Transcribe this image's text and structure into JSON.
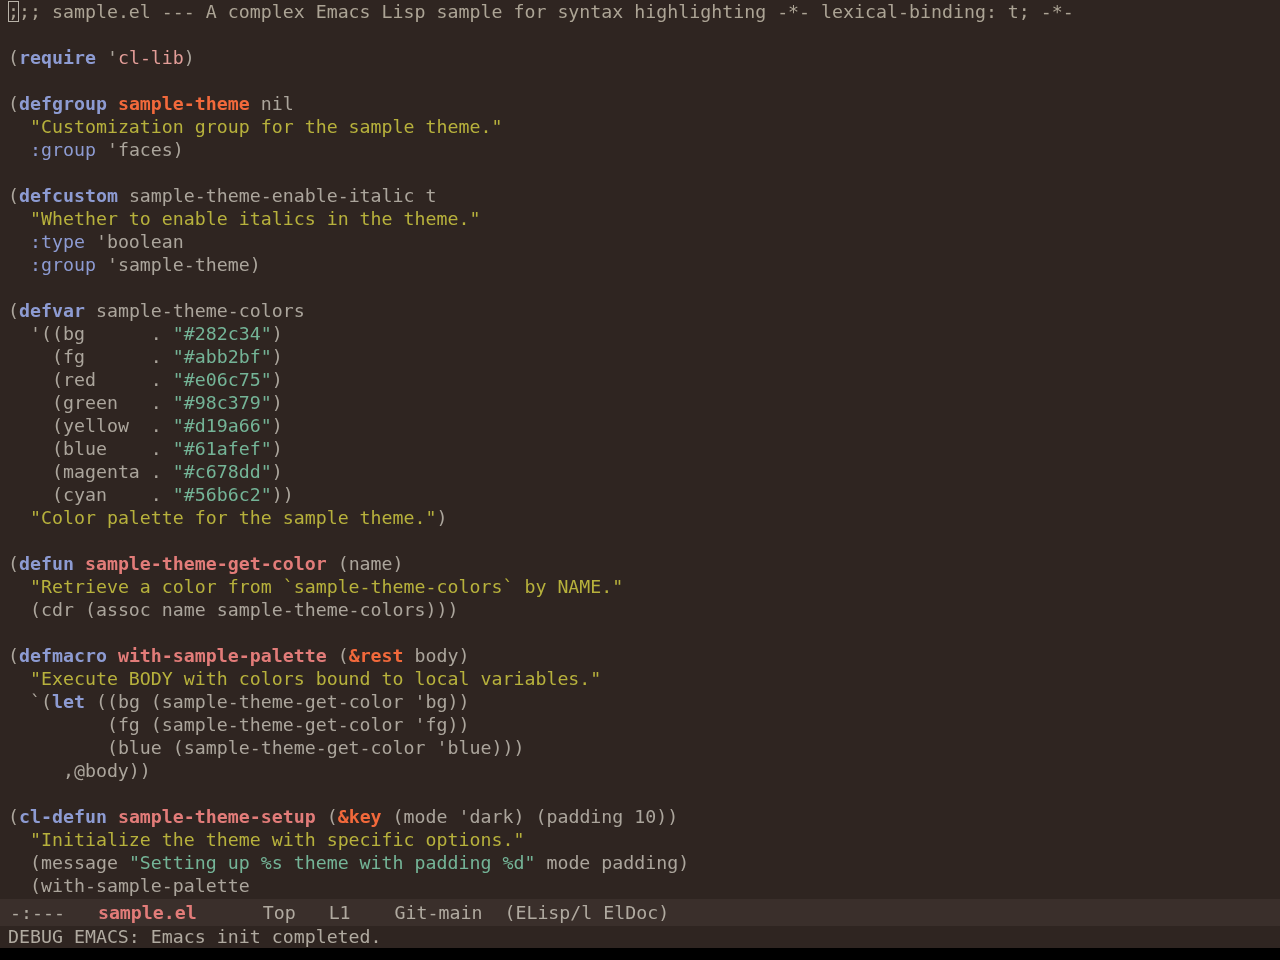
{
  "buffer": {
    "blocks": [
      {
        "lines": [
          {
            "segments": [
              {
                "text": ";",
                "kind": "comment",
                "cursor": true
              },
              {
                "text": ";; sample.el --- A complex Emacs Lisp sample for syntax highlighting -*- lexical-binding: t; -*-",
                "kind": "comment"
              }
            ]
          }
        ]
      },
      {
        "lines": [
          {
            "segments": [
              {
                "text": "(",
                "kind": "plain"
              },
              {
                "text": "require",
                "kind": "keyword"
              },
              {
                "text": " '",
                "kind": "plain"
              },
              {
                "text": "cl-lib",
                "kind": "constant"
              },
              {
                "text": ")",
                "kind": "plain"
              }
            ]
          }
        ]
      },
      {
        "lines": [
          {
            "segments": [
              {
                "text": "(",
                "kind": "plain"
              },
              {
                "text": "defgroup",
                "kind": "keyword"
              },
              {
                "text": " sample-theme",
                "kind": "type"
              },
              {
                "text": " nil",
                "kind": "plain"
              }
            ]
          },
          {
            "segments": [
              {
                "text": "  \"Customization group for the sample theme.\"",
                "kind": "docstring"
              }
            ]
          },
          {
            "segments": [
              {
                "text": "  :group",
                "kind": "keyword-arg"
              },
              {
                "text": " 'faces)",
                "kind": "plain"
              }
            ]
          }
        ]
      },
      {
        "lines": [
          {
            "segments": [
              {
                "text": "(",
                "kind": "plain"
              },
              {
                "text": "defcustom",
                "kind": "keyword"
              },
              {
                "text": " sample-theme-enable-italic t",
                "kind": "plain"
              }
            ]
          },
          {
            "segments": [
              {
                "text": "  \"Whether to enable italics in the theme.\"",
                "kind": "docstring"
              }
            ]
          },
          {
            "segments": [
              {
                "text": "  :type",
                "kind": "keyword-arg"
              },
              {
                "text": " 'boolean",
                "kind": "plain"
              }
            ]
          },
          {
            "segments": [
              {
                "text": "  :group",
                "kind": "keyword-arg"
              },
              {
                "text": " 'sample-theme)",
                "kind": "plain"
              }
            ]
          }
        ]
      },
      {
        "lines": [
          {
            "segments": [
              {
                "text": "(",
                "kind": "plain"
              },
              {
                "text": "defvar",
                "kind": "keyword"
              },
              {
                "text": " sample-theme-colors",
                "kind": "plain"
              }
            ]
          },
          {
            "segments": [
              {
                "text": "  '((bg      . ",
                "kind": "plain"
              },
              {
                "text": "\"#282c34\"",
                "kind": "string"
              },
              {
                "text": ")",
                "kind": "plain"
              }
            ]
          },
          {
            "segments": [
              {
                "text": "    (fg      . ",
                "kind": "plain"
              },
              {
                "text": "\"#abb2bf\"",
                "kind": "string"
              },
              {
                "text": ")",
                "kind": "plain"
              }
            ]
          },
          {
            "segments": [
              {
                "text": "    (red     . ",
                "kind": "plain"
              },
              {
                "text": "\"#e06c75\"",
                "kind": "string"
              },
              {
                "text": ")",
                "kind": "plain"
              }
            ]
          },
          {
            "segments": [
              {
                "text": "    (green   . ",
                "kind": "plain"
              },
              {
                "text": "\"#98c379\"",
                "kind": "string"
              },
              {
                "text": ")",
                "kind": "plain"
              }
            ]
          },
          {
            "segments": [
              {
                "text": "    (yellow  . ",
                "kind": "plain"
              },
              {
                "text": "\"#d19a66\"",
                "kind": "string"
              },
              {
                "text": ")",
                "kind": "plain"
              }
            ]
          },
          {
            "segments": [
              {
                "text": "    (blue    . ",
                "kind": "plain"
              },
              {
                "text": "\"#61afef\"",
                "kind": "string"
              },
              {
                "text": ")",
                "kind": "plain"
              }
            ]
          },
          {
            "segments": [
              {
                "text": "    (magenta . ",
                "kind": "plain"
              },
              {
                "text": "\"#c678dd\"",
                "kind": "string"
              },
              {
                "text": ")",
                "kind": "plain"
              }
            ]
          },
          {
            "segments": [
              {
                "text": "    (cyan    . ",
                "kind": "plain"
              },
              {
                "text": "\"#56b6c2\"",
                "kind": "string"
              },
              {
                "text": "))",
                "kind": "plain"
              }
            ]
          },
          {
            "segments": [
              {
                "text": "  \"Color palette for the sample theme.\"",
                "kind": "docstring"
              },
              {
                "text": ")",
                "kind": "plain"
              }
            ]
          }
        ]
      },
      {
        "lines": [
          {
            "segments": [
              {
                "text": "(",
                "kind": "plain"
              },
              {
                "text": "defun",
                "kind": "keyword"
              },
              {
                "text": " sample-theme-get-color",
                "kind": "function"
              },
              {
                "text": " (name)",
                "kind": "plain"
              }
            ]
          },
          {
            "segments": [
              {
                "text": "  \"Retrieve a color from `sample-theme-colors` by NAME.\"",
                "kind": "docstring"
              }
            ]
          },
          {
            "segments": [
              {
                "text": "  (cdr (assoc name sample-theme-colors)))",
                "kind": "plain"
              }
            ]
          }
        ]
      },
      {
        "lines": [
          {
            "segments": [
              {
                "text": "(",
                "kind": "plain"
              },
              {
                "text": "defmacro",
                "kind": "keyword"
              },
              {
                "text": " with-sample-palette",
                "kind": "function"
              },
              {
                "text": " (",
                "kind": "plain"
              },
              {
                "text": "&rest",
                "kind": "lambda-keyword"
              },
              {
                "text": " body)",
                "kind": "plain"
              }
            ]
          },
          {
            "segments": [
              {
                "text": "  \"Execute BODY with colors bound to local variables.\"",
                "kind": "docstring"
              }
            ]
          },
          {
            "segments": [
              {
                "text": "  `(",
                "kind": "plain"
              },
              {
                "text": "let",
                "kind": "keyword"
              },
              {
                "text": " ((bg (sample-theme-get-color 'bg))",
                "kind": "plain"
              }
            ]
          },
          {
            "segments": [
              {
                "text": "         (fg (sample-theme-get-color 'fg))",
                "kind": "plain"
              }
            ]
          },
          {
            "segments": [
              {
                "text": "         (blue (sample-theme-get-color 'blue)))",
                "kind": "plain"
              }
            ]
          },
          {
            "segments": [
              {
                "text": "     ,@body))",
                "kind": "plain"
              }
            ]
          }
        ]
      },
      {
        "lines": [
          {
            "segments": [
              {
                "text": "(",
                "kind": "plain"
              },
              {
                "text": "cl-defun",
                "kind": "keyword"
              },
              {
                "text": " sample-theme-setup",
                "kind": "function"
              },
              {
                "text": " (",
                "kind": "plain"
              },
              {
                "text": "&key",
                "kind": "lambda-keyword"
              },
              {
                "text": " (mode 'dark) (padding 10))",
                "kind": "plain"
              }
            ]
          },
          {
            "segments": [
              {
                "text": "  \"Initialize the theme with specific options.\"",
                "kind": "docstring"
              }
            ]
          },
          {
            "segments": [
              {
                "text": "  (message ",
                "kind": "plain"
              },
              {
                "text": "\"Setting up %s theme with padding %d\"",
                "kind": "string"
              },
              {
                "text": " mode padding)",
                "kind": "plain"
              }
            ]
          },
          {
            "segments": [
              {
                "text": "  (with-sample-palette",
                "kind": "plain"
              }
            ]
          }
        ]
      }
    ]
  },
  "mode_line": {
    "status": "-:---",
    "buffer_name": "sample.el",
    "position": "Top",
    "line": "L1",
    "branch": "Git-main",
    "modes": "(ELisp/l ElDoc)"
  },
  "echo_area": {
    "message": "DEBUG EMACS: Emacs init completed."
  }
}
